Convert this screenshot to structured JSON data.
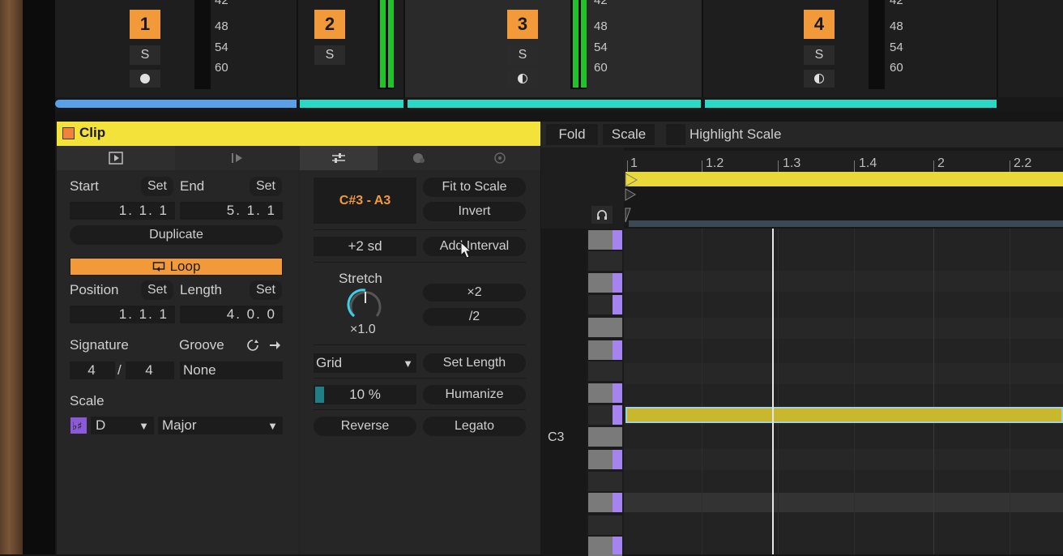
{
  "mixer": {
    "strips": [
      {
        "number": "1",
        "solo": "S",
        "monitor": "dot",
        "bar_color": "#5aa0e8"
      },
      {
        "number": "2",
        "solo": "S",
        "monitor": "none",
        "bar_color": "#2ad8c6"
      },
      {
        "number": "3",
        "solo": "S",
        "monitor": "half",
        "bar_color": "#2ad8c6"
      },
      {
        "number": "4",
        "solo": "S",
        "monitor": "half",
        "bar_color": "#2ad8c6"
      }
    ],
    "db_labels": [
      "42",
      "48",
      "54",
      "60"
    ]
  },
  "clip": {
    "title": "Clip",
    "start_label": "Start",
    "end_label": "End",
    "set_label": "Set",
    "start_value": "1. 1. 1",
    "end_value": "5. 1. 1",
    "duplicate_label": "Duplicate",
    "loop_label": "Loop",
    "position_label": "Position",
    "length_label": "Length",
    "position_value": "1. 1. 1",
    "length_value": "4. 0. 0",
    "signature_label": "Signature",
    "groove_label": "Groove",
    "sig_num": "4",
    "sig_sep": "/",
    "sig_den": "4",
    "groove_value": "None",
    "scale_label": "Scale",
    "scale_root": "D",
    "scale_mode": "Major"
  },
  "transform": {
    "range": "C#3 - A3",
    "fit_to_scale": "Fit to Scale",
    "invert": "Invert",
    "transpose": "+2 sd",
    "add_interval": "Add Interval",
    "stretch_label": "Stretch",
    "stretch_value": "×1.0",
    "times2": "×2",
    "div2": "/2",
    "grid": "Grid",
    "set_length": "Set Length",
    "humanize_amount": "10 %",
    "humanize": "Humanize",
    "reverse": "Reverse",
    "legato": "Legato"
  },
  "editor": {
    "fold": "Fold",
    "scale": "Scale",
    "highlight_scale": "Highlight Scale",
    "ruler_labels": [
      "1",
      "1.2",
      "1.3",
      "1.4",
      "2",
      "2.2"
    ],
    "c3_label": "C3"
  }
}
